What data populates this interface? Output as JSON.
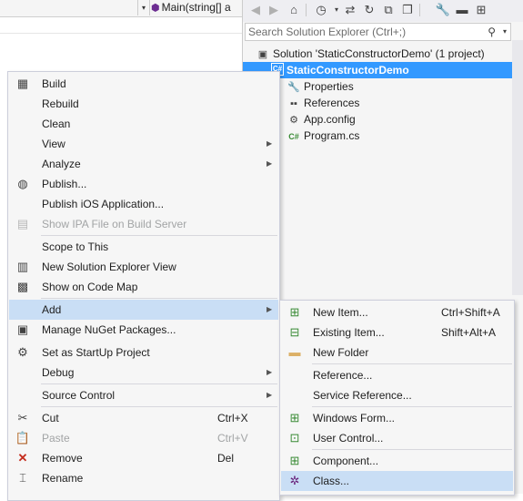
{
  "editor": {
    "method_dropdown_text": "Main(string[] a",
    "dropdown_arrow": "▾"
  },
  "solution_explorer": {
    "toolbar": {
      "icons": [
        "back-icon",
        "forward-icon",
        "home-icon",
        "history-icon",
        "sync-icon",
        "refresh-icon",
        "collapse-all-icon",
        "show-all-files-icon",
        "properties-icon",
        "preview-icon",
        "view-class-diagram-icon"
      ]
    },
    "search": {
      "placeholder": "Search Solution Explorer (Ctrl+;)",
      "icon": "⚲",
      "dropdown": "▾"
    },
    "tree": [
      {
        "label": "Solution 'StaticConstructorDemo' (1 project)",
        "icon": "solution-icon"
      },
      {
        "label": "StaticConstructorDemo",
        "icon": "csharp-project-icon",
        "selected": true
      },
      {
        "label": "Properties",
        "icon": "wrench-icon"
      },
      {
        "label": "References",
        "icon": "references-icon"
      },
      {
        "label": "App.config",
        "icon": "config-file-icon"
      },
      {
        "label": "Program.cs",
        "icon": "csharp-file-icon"
      }
    ]
  },
  "context_menu": {
    "items": [
      {
        "label": "Build",
        "icon": "build-icon"
      },
      {
        "label": "Rebuild"
      },
      {
        "label": "Clean"
      },
      {
        "label": "View",
        "submenu": true
      },
      {
        "label": "Analyze",
        "submenu": true
      },
      {
        "label": "Publish...",
        "icon": "publish-globe-icon"
      },
      {
        "label": "Publish iOS Application..."
      },
      {
        "label": "Show IPA File on Build Server",
        "icon": "ipa-file-icon",
        "disabled": true
      },
      {
        "label": "Scope to This"
      },
      {
        "label": "New Solution Explorer View",
        "icon": "new-window-icon"
      },
      {
        "label": "Show on Code Map",
        "icon": "code-map-icon"
      },
      {
        "label": "Add",
        "submenu": true,
        "highlighted": true
      },
      {
        "label": "Manage NuGet Packages...",
        "icon": "nuget-icon"
      },
      {
        "label": "Set as StartUp Project",
        "icon": "gear-icon"
      },
      {
        "label": "Debug",
        "submenu": true
      },
      {
        "label": "Source Control",
        "submenu": true
      },
      {
        "label": "Cut",
        "icon": "scissors-icon",
        "shortcut": "Ctrl+X"
      },
      {
        "label": "Paste",
        "icon": "clipboard-icon",
        "shortcut": "Ctrl+V",
        "disabled": true
      },
      {
        "label": "Remove",
        "icon": "red-x-icon",
        "shortcut": "Del"
      },
      {
        "label": "Rename",
        "icon": "rename-icon"
      }
    ]
  },
  "add_submenu": {
    "items": [
      {
        "label": "New Item...",
        "icon": "new-item-icon",
        "shortcut": "Ctrl+Shift+A"
      },
      {
        "label": "Existing Item...",
        "icon": "existing-item-icon",
        "shortcut": "Shift+Alt+A"
      },
      {
        "label": "New Folder",
        "icon": "new-folder-icon"
      },
      {
        "label": "Reference..."
      },
      {
        "label": "Service Reference..."
      },
      {
        "label": "Windows Form...",
        "icon": "windows-form-icon"
      },
      {
        "label": "User Control...",
        "icon": "user-control-icon"
      },
      {
        "label": "Component...",
        "icon": "component-icon"
      },
      {
        "label": "Class...",
        "icon": "class-icon",
        "highlighted": true
      }
    ]
  }
}
